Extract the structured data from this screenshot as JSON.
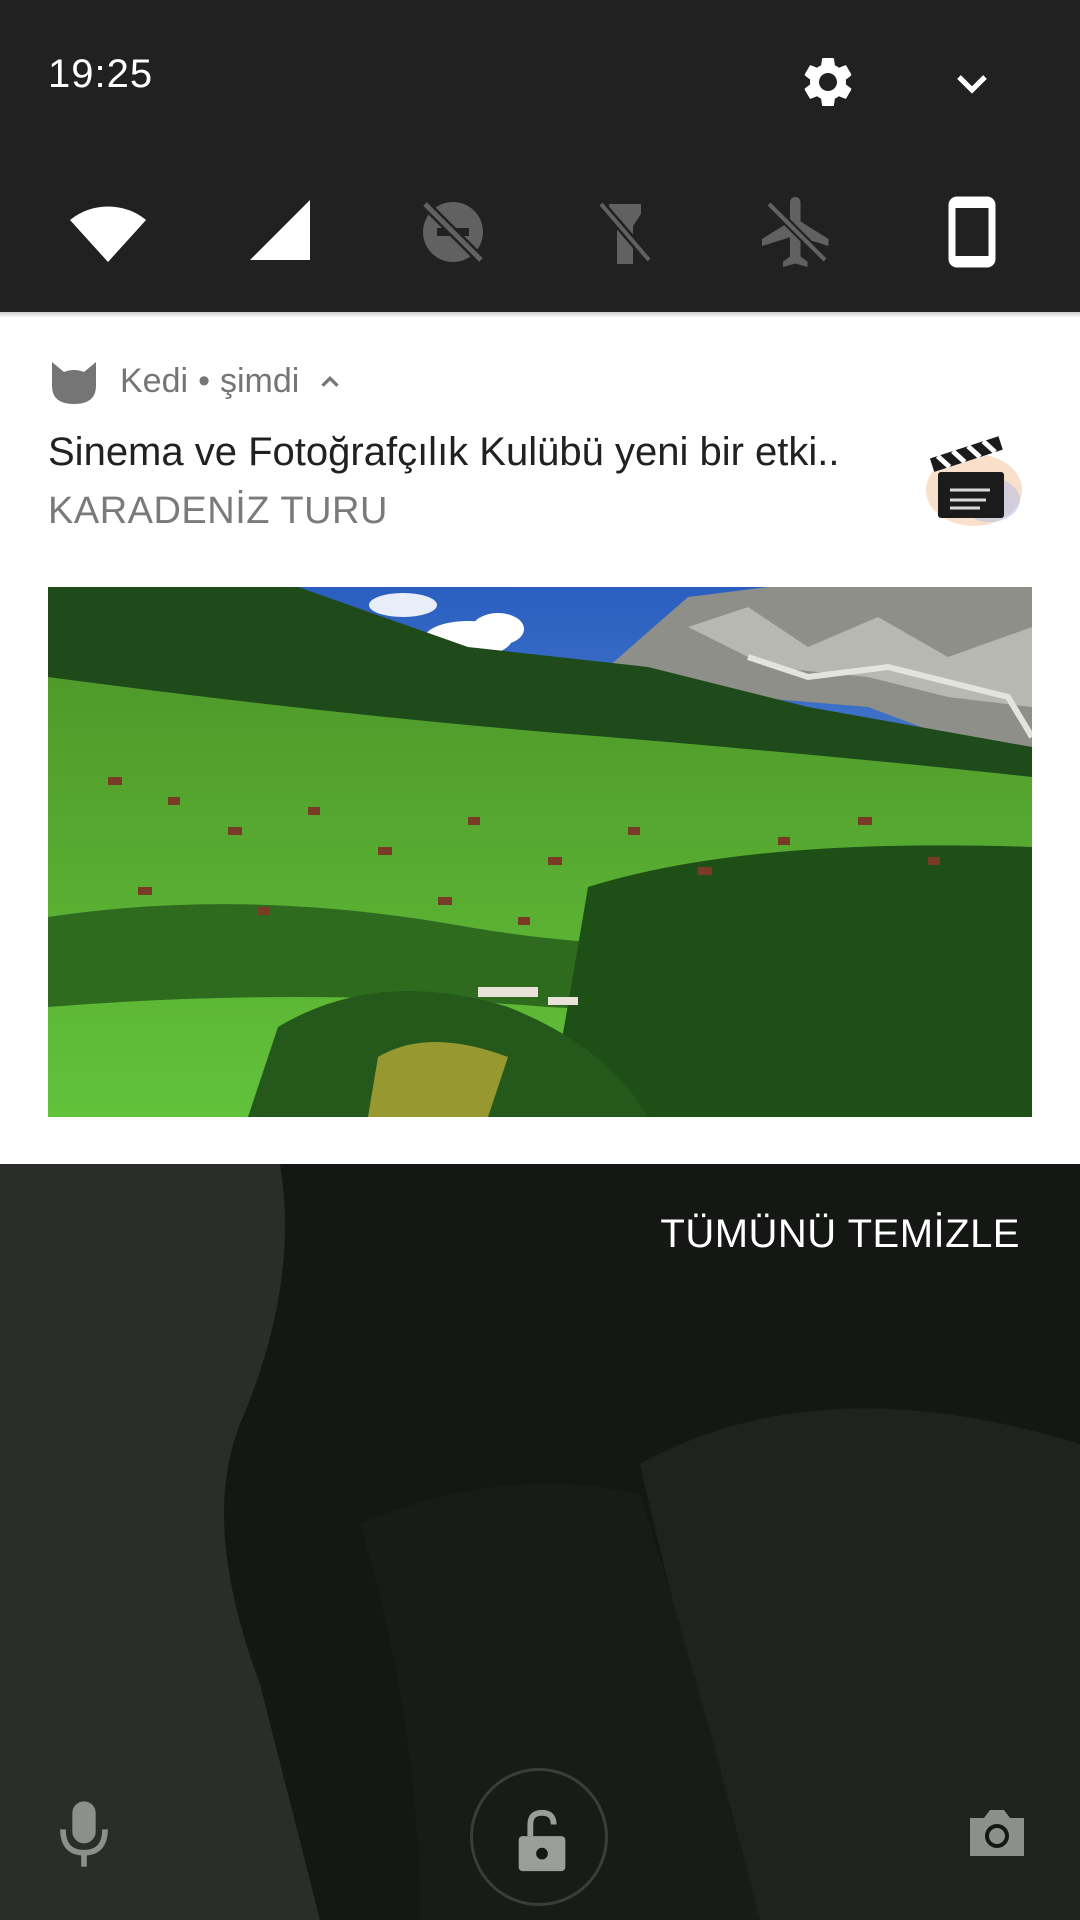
{
  "status": {
    "time": "19:25"
  },
  "quick_settings": {
    "tiles": [
      {
        "icon": "wifi-icon",
        "state": "on"
      },
      {
        "icon": "cellular-signal-icon",
        "state": "on"
      },
      {
        "icon": "do-not-disturb-off-icon",
        "state": "off"
      },
      {
        "icon": "flashlight-off-icon",
        "state": "off"
      },
      {
        "icon": "airplane-mode-off-icon",
        "state": "off"
      },
      {
        "icon": "auto-rotate-portrait-icon",
        "state": "on"
      }
    ]
  },
  "notification": {
    "app_name": "Kedi",
    "separator": "•",
    "time": "şimdi",
    "title": "Sinema ve Fotoğrafçılık Kulübü yeni bir etki..",
    "subtitle": "KARADENİZ TURU",
    "thumbnail_icon": "clapperboard-icon",
    "image": "mountain-village-landscape"
  },
  "lockscreen": {
    "clear_all_label": "TÜMÜNÜ TEMİZLE",
    "left_shortcut_icon": "microphone-icon",
    "center_icon": "unlocked-padlock-icon",
    "right_shortcut_icon": "camera-icon"
  },
  "colors": {
    "panel_bg": "#212121",
    "notification_bg": "#ffffff",
    "lockscreen_bg": "#151715",
    "active_icon": "#ffffff",
    "inactive_icon": "#616161"
  }
}
